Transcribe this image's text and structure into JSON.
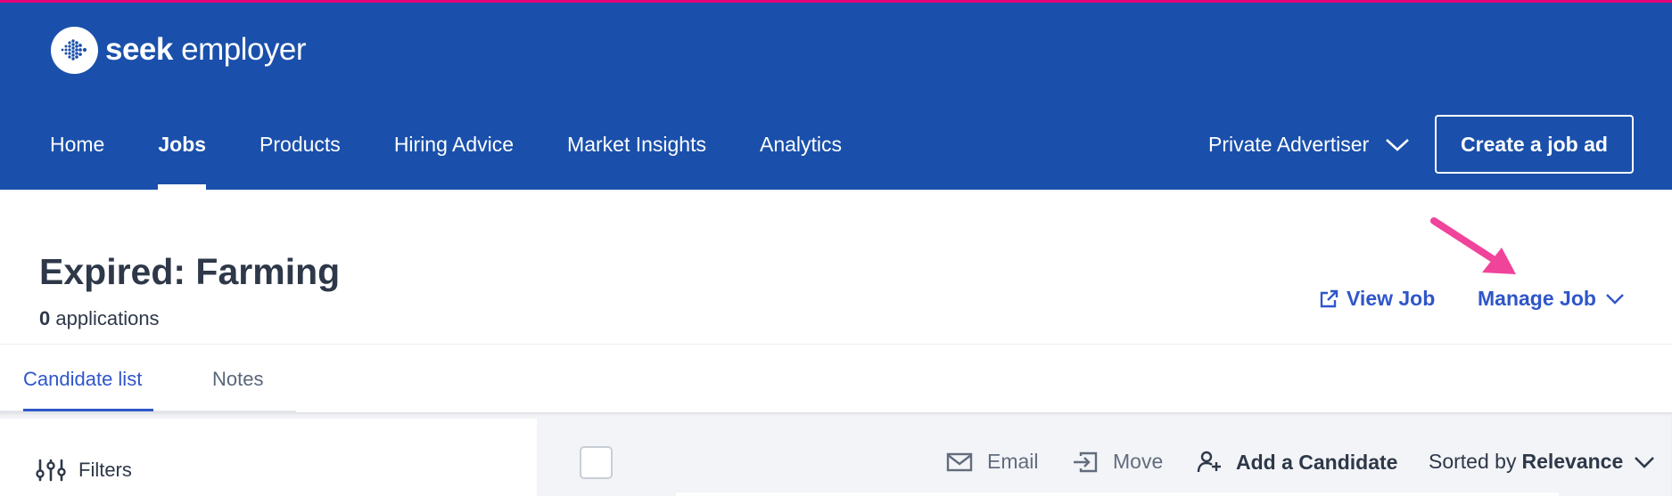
{
  "brand": {
    "name_bold": "seek",
    "name_light": " employer",
    "accent": "#e60278",
    "header_bg": "#1a50ab",
    "link_color": "#2f56c9"
  },
  "nav": {
    "items": [
      {
        "label": "Home",
        "active": false
      },
      {
        "label": "Jobs",
        "active": true
      },
      {
        "label": "Products",
        "active": false
      },
      {
        "label": "Hiring Advice",
        "active": false
      },
      {
        "label": "Market Insights",
        "active": false
      },
      {
        "label": "Analytics",
        "active": false
      }
    ],
    "account_label": "Private Advertiser",
    "create_label": "Create a job ad"
  },
  "job": {
    "title": "Expired: Farming",
    "application_count": "0",
    "applications_label": " applications",
    "view_job_label": "View Job",
    "manage_job_label": "Manage Job"
  },
  "tabs": [
    {
      "label": "Candidate list",
      "active": true
    },
    {
      "label": "Notes",
      "active": false
    }
  ],
  "filters": {
    "label": "Filters"
  },
  "toolbar": {
    "email_label": "Email",
    "move_label": "Move",
    "add_candidate_label": "Add a Candidate",
    "sorted_prefix": "Sorted by",
    "sorted_value": "Relevance"
  },
  "icons": [
    "seek-logo-icon",
    "chevron-down-icon",
    "external-link-icon",
    "arrow-annotation-icon",
    "sliders-icon",
    "mail-icon",
    "move-icon",
    "add-person-icon"
  ]
}
